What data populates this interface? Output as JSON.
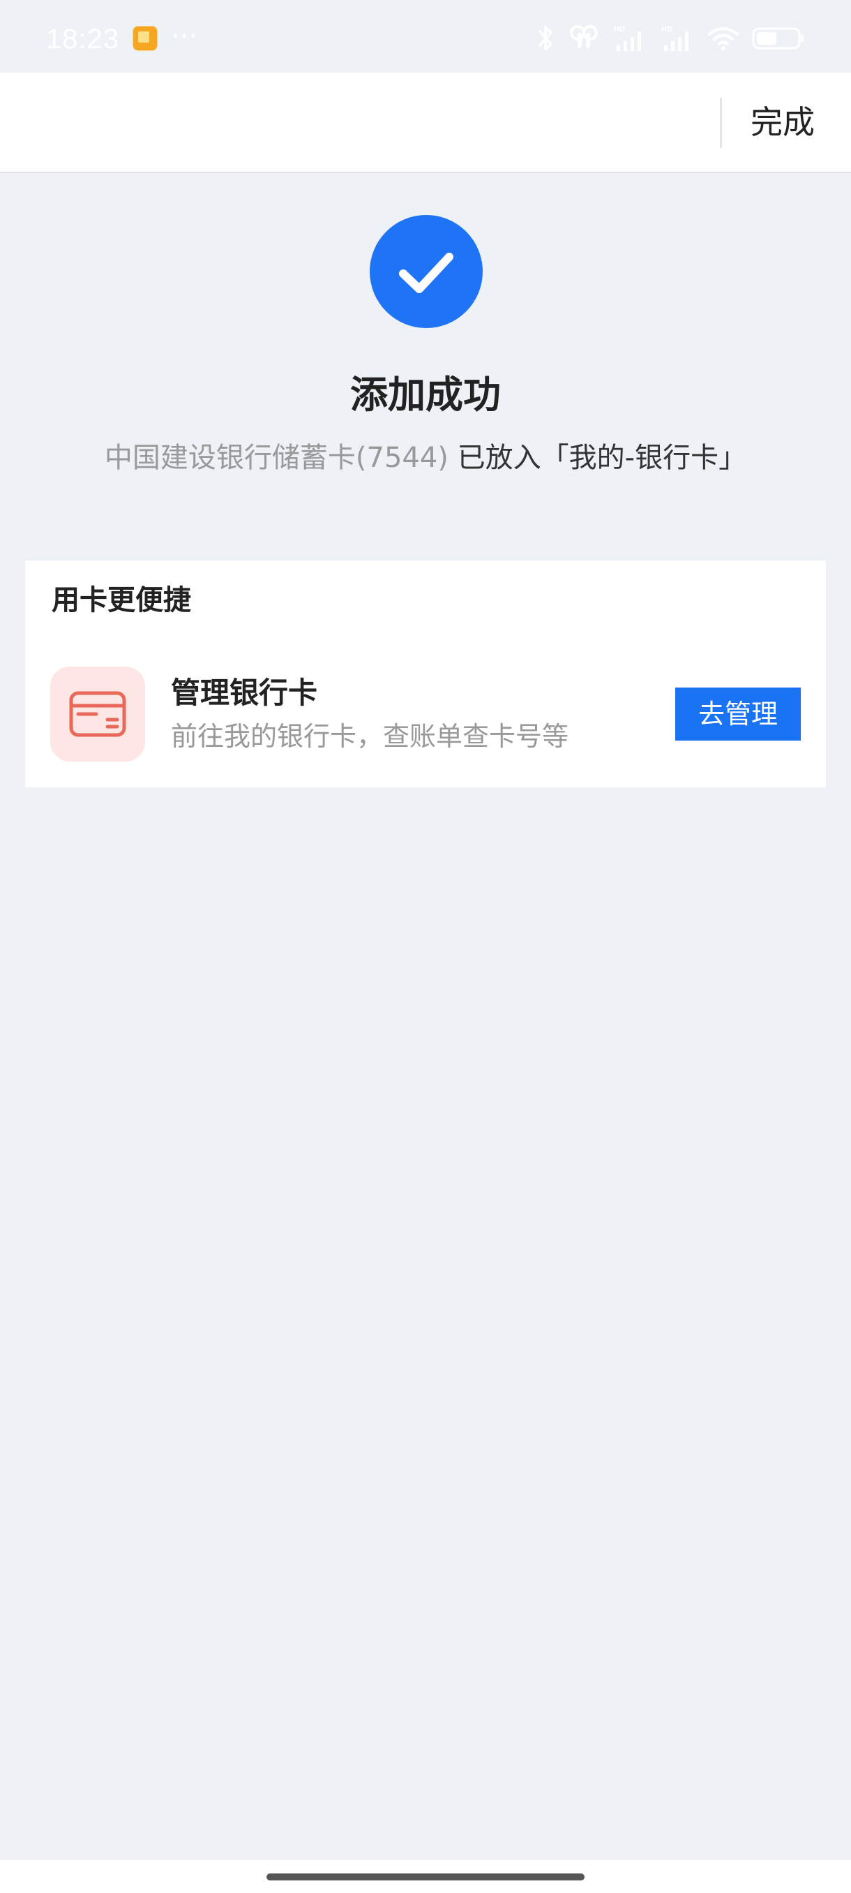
{
  "status_bar": {
    "time": "18:23",
    "more": "···",
    "icons": [
      "app-notification-icon",
      "bluetooth-icon",
      "earbuds-icon",
      "hd-signal-icon",
      "hd-signal-icon",
      "wifi-icon",
      "battery-icon"
    ]
  },
  "top_bar": {
    "done_label": "完成"
  },
  "success": {
    "icon": "checkmark-icon",
    "title": "添加成功",
    "card_name": "中国建设银行储蓄卡(7544)",
    "placed_text": "已放入「我的-银行卡」"
  },
  "card_section": {
    "title": "用卡更便捷",
    "item": {
      "icon": "bank-card-icon",
      "title": "管理银行卡",
      "description": "前往我的银行卡，查账单查卡号等",
      "button_label": "去管理"
    }
  },
  "colors": {
    "accent": "#1a73f3",
    "background": "#eef1f6",
    "icon_tint": "#e8685a",
    "icon_bg": "#fde6e3"
  }
}
